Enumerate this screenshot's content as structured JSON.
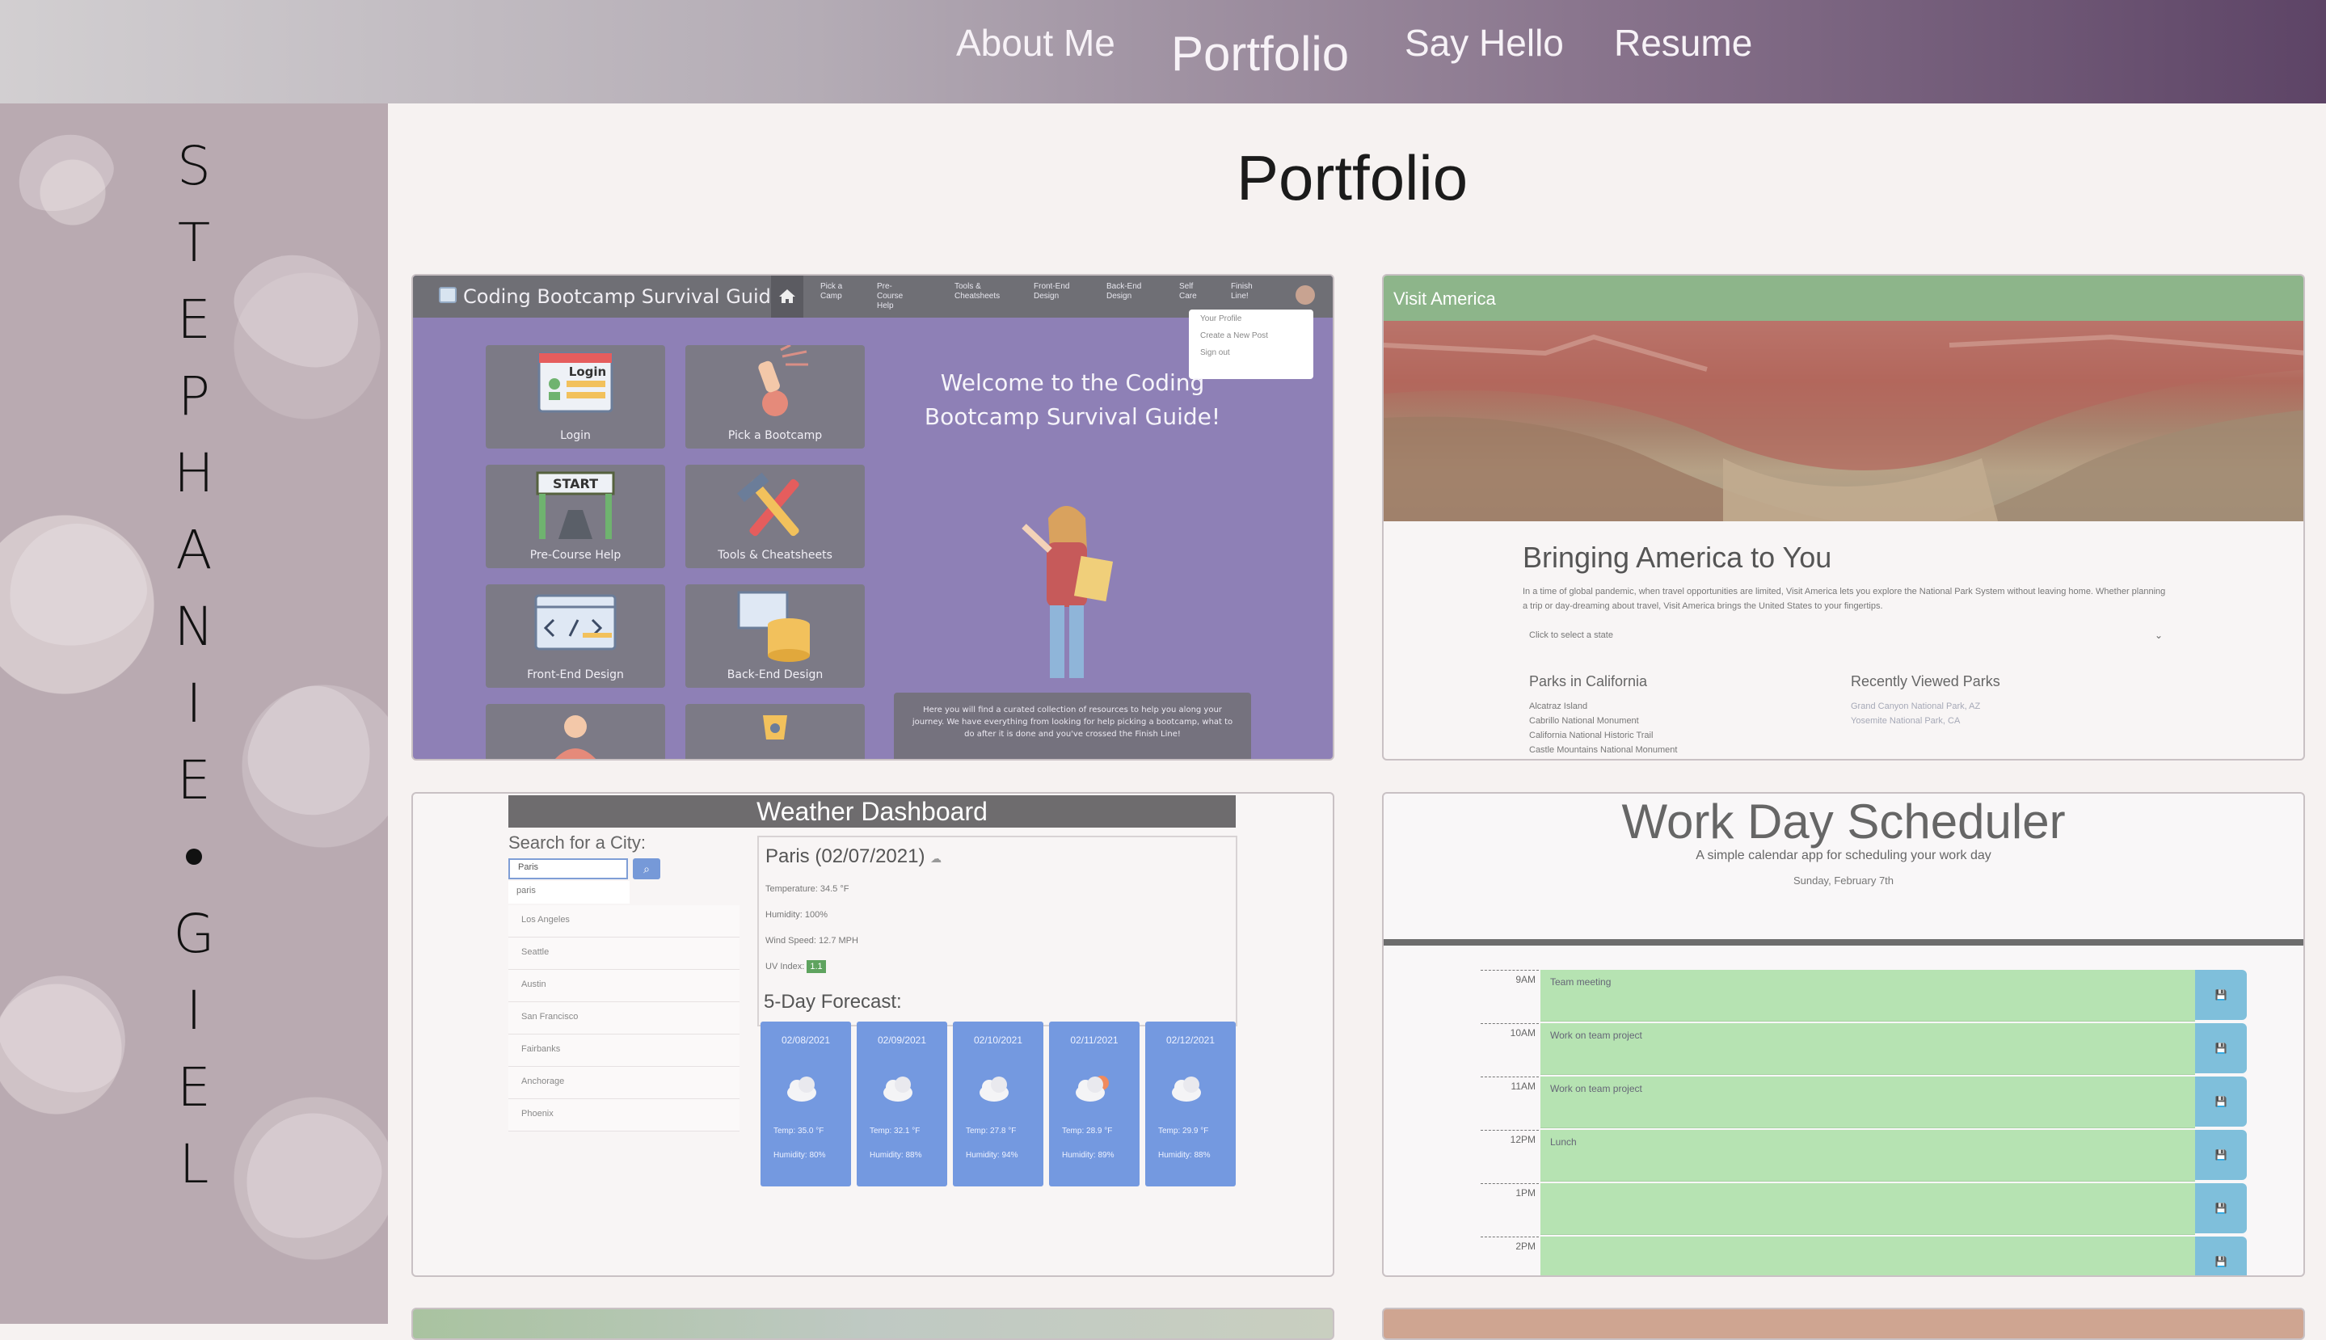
{
  "nav": {
    "about": "About Me",
    "portfolio": "Portfolio",
    "say_hello": "Say Hello",
    "resume": "Resume"
  },
  "sidebar": {
    "letters": [
      "S",
      "T",
      "E",
      "P",
      "H",
      "A",
      "N",
      "I",
      "E",
      "•",
      "G",
      "I",
      "E",
      "L"
    ]
  },
  "main": {
    "title": "Portfolio"
  },
  "projects": {
    "bootcamp": {
      "title": "Coding Bootcamp Survival Guide",
      "nav_items": [
        "Pick a\nCamp",
        "Pre-\nCourse\nHelp",
        "Tools &\nCheatsheets",
        "Front-End\nDesign",
        "Back-End\nDesign",
        "Self\nCare",
        "Finish\nLine!"
      ],
      "menu": [
        "Your Profile",
        "Create a New Post",
        "Sign out"
      ],
      "tiles": [
        "Login",
        "Pick a Bootcamp",
        "Pre-Course Help",
        "Tools & Cheatsheets",
        "Front-End Design",
        "Back-End Design"
      ],
      "tile_login_word": "Login",
      "tile_start_word": "START",
      "welcome": "Welcome to the Coding Bootcamp Survival Guide!",
      "description": "Here you will find a curated collection of resources to help you along your journey. We have everything from looking for help picking a bootcamp, what to do after it is done and you've crossed the Finish Line!"
    },
    "visit_america": {
      "brand": "Visit America",
      "heading": "Bringing America to You",
      "text": "In a time of global pandemic, when travel opportunities are limited, Visit America lets you explore the National Park System without leaving home. Whether planning a trip or day-dreaming about travel, Visit America brings the United States to your fingertips.",
      "select_placeholder": "Click to select a state",
      "parks_heading": "Parks in California",
      "parks": [
        "Alcatraz Island",
        "Cabrillo National Monument",
        "California National Historic Trail",
        "Castle Mountains National Monument"
      ],
      "recent_heading": "Recently Viewed Parks",
      "recent": [
        "Grand Canyon National Park, AZ",
        "Yosemite National Park, CA"
      ]
    },
    "weather": {
      "banner": "Weather Dashboard",
      "search_label": "Search for a City:",
      "search_value": "Paris",
      "dropdown_suggestion": "paris",
      "cities": [
        "Los Angeles",
        "Seattle",
        "Austin",
        "San Francisco",
        "Fairbanks",
        "Anchorage",
        "Phoenix"
      ],
      "current_title": "Paris (02/07/2021)",
      "temperature": "Temperature: 34.5 °F",
      "humidity": "Humidity: 100%",
      "wind": "Wind Speed: 12.7 MPH",
      "uv_label": "UV Index:",
      "uv_value": "1.1",
      "forecast_heading": "5-Day Forecast:",
      "forecast": [
        {
          "date": "02/08/2021",
          "temp": "Temp: 35.0 °F",
          "humidity": "Humidity: 80%",
          "icon": "cloud-icon"
        },
        {
          "date": "02/09/2021",
          "temp": "Temp: 32.1 °F",
          "humidity": "Humidity: 88%",
          "icon": "cloud-icon"
        },
        {
          "date": "02/10/2021",
          "temp": "Temp: 27.8 °F",
          "humidity": "Humidity: 94%",
          "icon": "cloud-icon"
        },
        {
          "date": "02/11/2021",
          "temp": "Temp: 28.9 °F",
          "humidity": "Humidity: 89%",
          "icon": "cloud-sun-icon"
        },
        {
          "date": "02/12/2021",
          "temp": "Temp: 29.9 °F",
          "humidity": "Humidity: 88%",
          "icon": "cloud-icon"
        }
      ]
    },
    "scheduler": {
      "title": "Work Day Scheduler",
      "subtitle": "A simple calendar app for scheduling your work day",
      "date": "Sunday, February 7th",
      "rows": [
        {
          "hour": "9AM",
          "text": "Team meeting"
        },
        {
          "hour": "10AM",
          "text": "Work on team project"
        },
        {
          "hour": "11AM",
          "text": "Work on team project"
        },
        {
          "hour": "12PM",
          "text": "Lunch"
        },
        {
          "hour": "1PM",
          "text": ""
        },
        {
          "hour": "2PM",
          "text": ""
        }
      ]
    }
  }
}
